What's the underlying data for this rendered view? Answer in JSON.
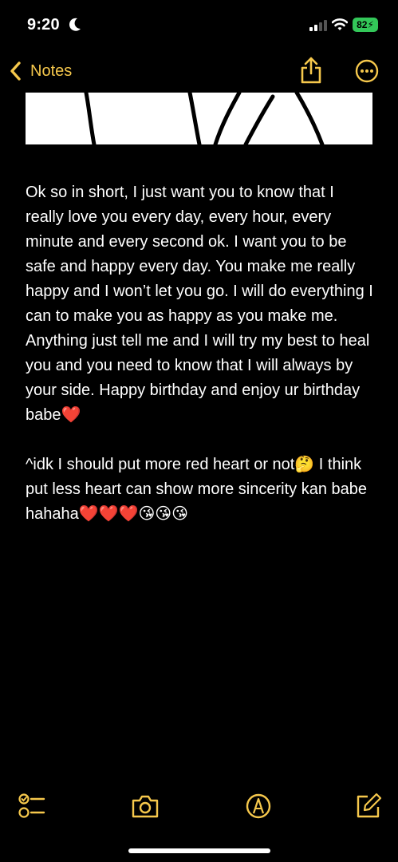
{
  "status_bar": {
    "time": "9:20",
    "battery": "82",
    "icons": [
      "moon-icon",
      "signal-icon",
      "wifi-icon",
      "battery-icon"
    ]
  },
  "nav": {
    "back_label": "Notes",
    "icons": [
      "chevron-left-icon",
      "share-icon",
      "more-icon"
    ]
  },
  "colors": {
    "accent": "#f6c84c",
    "background": "#000000",
    "text": "#ffffff",
    "battery": "#33c759"
  },
  "note": {
    "paragraph1": "Ok so in short, I just want you to know that I really love you every day, every hour, every minute and every second ok. I want you to be safe and happy every day. You make me really happy and I won’t let you go. I will do everything I can to make you as happy as you make me. Anything just tell me and I will try my best to heal you and you need to know that I will always by your side. Happy birthday and enjoy ur birthday babe❤️",
    "paragraph2": "^idk I should put more red heart or not🤔 I think put less heart can show more sincerity kan babe hahaha❤️❤️❤️😘😘😘"
  },
  "toolbar": {
    "icons": [
      "checklist-icon",
      "camera-icon",
      "markup-icon",
      "compose-icon"
    ]
  }
}
